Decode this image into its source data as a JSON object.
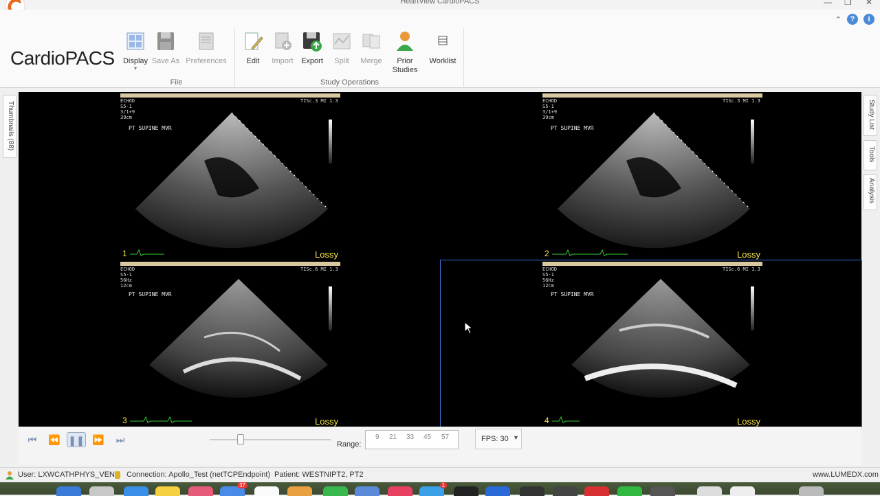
{
  "window": {
    "title": "HeartView CardioPACS"
  },
  "ribbon": {
    "brand": "CardioPACS",
    "groups": {
      "file": {
        "label": "File",
        "display": "Display",
        "save_as": "Save As",
        "preferences": "Preferences"
      },
      "study_ops": {
        "label": "Study Operations",
        "edit": "Edit",
        "import": "Import",
        "export": "Export",
        "split": "Split",
        "merge": "Merge",
        "prior_studies": "Prior Studies",
        "worklist": "Worklist"
      }
    }
  },
  "sidebar_left": {
    "thumbnails": "Thumbnails (88)"
  },
  "sidebar_right": {
    "study_list": "Study List",
    "tools": "Tools",
    "analysis": "Analysis"
  },
  "panes": [
    {
      "num": "1",
      "lossy": "Lossy",
      "label": "PT SUPINE  MVR",
      "header": "ECHOD\nS5-1\n3/1+9\n39cm",
      "tis": "TISc.3  MI 1.3"
    },
    {
      "num": "2",
      "lossy": "Lossy",
      "label": "PT SUPINE  MVR",
      "header": "ECHOD\nS5-1\n3/1+9\n39cm",
      "tis": "TISc.3  MI 1.3"
    },
    {
      "num": "3",
      "lossy": "Lossy",
      "label": "PT SUPINE  MVR",
      "header": "ECHOD\nS5-1\n56Hz\n12cm",
      "tis": "TISc.6  MI 1.3"
    },
    {
      "num": "4",
      "lossy": "Lossy",
      "label": "PT SUPINE  MVR",
      "header": "ECHOD\nS5-1\n56Hz\n12cm",
      "tis": "TISc.6  MI 1.3"
    }
  ],
  "playback": {
    "range_label": "Range:",
    "range_ticks": [
      "9",
      "21",
      "33",
      "45",
      "57"
    ],
    "fps": "FPS: 30"
  },
  "status": {
    "user": "User: LXWCATHPHYS_VEN",
    "connection": "Connection: Apollo_Test (netTCPEndpoint)",
    "patient": "Patient: WESTNIPT2, PT2",
    "site": "www.LUMEDX.com"
  },
  "dock": {
    "badge_mail": "37",
    "badge_app": "1"
  }
}
